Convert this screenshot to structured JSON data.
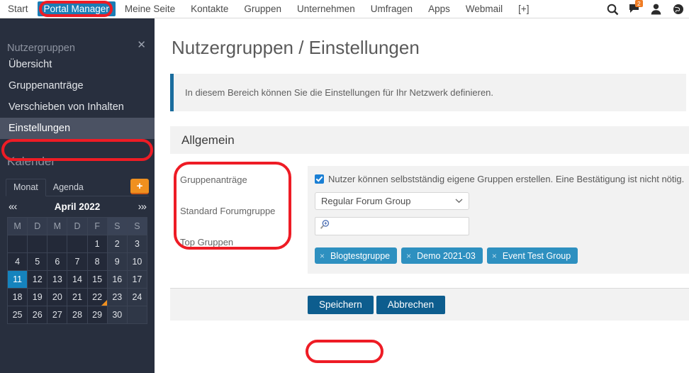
{
  "topnav": {
    "items": [
      {
        "label": "Start",
        "active": false
      },
      {
        "label": "Portal Manager",
        "active": true
      },
      {
        "label": "Meine Seite",
        "active": false
      },
      {
        "label": "Kontakte",
        "active": false
      },
      {
        "label": "Gruppen",
        "active": false
      },
      {
        "label": "Unternehmen",
        "active": false
      },
      {
        "label": "Umfragen",
        "active": false
      },
      {
        "label": "Apps",
        "active": false
      },
      {
        "label": "Webmail",
        "active": false
      },
      {
        "label": "[+]",
        "active": false
      }
    ],
    "icons": [
      {
        "name": "search-icon"
      },
      {
        "name": "messages-icon",
        "badge": "2"
      },
      {
        "name": "user-icon"
      },
      {
        "name": "globe-icon"
      }
    ]
  },
  "sidebar": {
    "close_label": "✕",
    "section_title": "Nutzergruppen",
    "items": [
      {
        "label": "Übersicht",
        "selected": false
      },
      {
        "label": "Gruppenanträge",
        "selected": false
      },
      {
        "label": "Verschieben von Inhalten",
        "selected": false
      },
      {
        "label": "Einstellungen",
        "selected": true
      }
    ],
    "calendar": {
      "title": "Kalender",
      "tabs": [
        {
          "label": "Monat",
          "active": true
        },
        {
          "label": "Agenda",
          "active": false
        }
      ],
      "add_label": "+",
      "nav_prev": "«‹",
      "nav_next": "›»",
      "month": "April 2022",
      "weekdays": [
        "M",
        "D",
        "M",
        "D",
        "F",
        "S",
        "S"
      ],
      "weeks": [
        [
          "",
          "",
          "",
          "",
          "1",
          "2",
          "3"
        ],
        [
          "4",
          "5",
          "6",
          "7",
          "8",
          "9",
          "10"
        ],
        [
          "11",
          "12",
          "13",
          "14",
          "15",
          "16",
          "17"
        ],
        [
          "18",
          "19",
          "20",
          "21",
          "22",
          "23",
          "24"
        ],
        [
          "25",
          "26",
          "27",
          "28",
          "29",
          "30",
          ""
        ]
      ],
      "today": "11",
      "marked": "22"
    }
  },
  "main": {
    "page_title": "Nutzergruppen / Einstellungen",
    "info_text": "In diesem Bereich können Sie die Einstellungen für Ihr Netzwerk definieren.",
    "section_title": "Allgemein",
    "labels": [
      "Gruppenanträge",
      "Standard Forumgruppe",
      "Top Gruppen"
    ],
    "checkbox_label": "Nutzer können selbstständig eigene Gruppen erstellen. Eine Bestätigung ist nicht nötig.",
    "checkbox_checked": true,
    "select_value": "Regular Forum Group",
    "select_chevron": "⌄",
    "search_placeholder": "",
    "search_value": "",
    "chips": [
      {
        "label": "Blogtestgruppe",
        "close": "×"
      },
      {
        "label": "Demo 2021-03",
        "close": "×"
      },
      {
        "label": "Event Test Group",
        "close": "×"
      }
    ],
    "save_label": "Speichern",
    "cancel_label": "Abbrechen"
  },
  "annotations": {
    "color": "#ee1c25",
    "targets": [
      "Portal Manager",
      "Einstellungen",
      "Gruppenanträge / Standard Forumgruppe / Top Gruppen",
      "Speichern"
    ]
  }
}
